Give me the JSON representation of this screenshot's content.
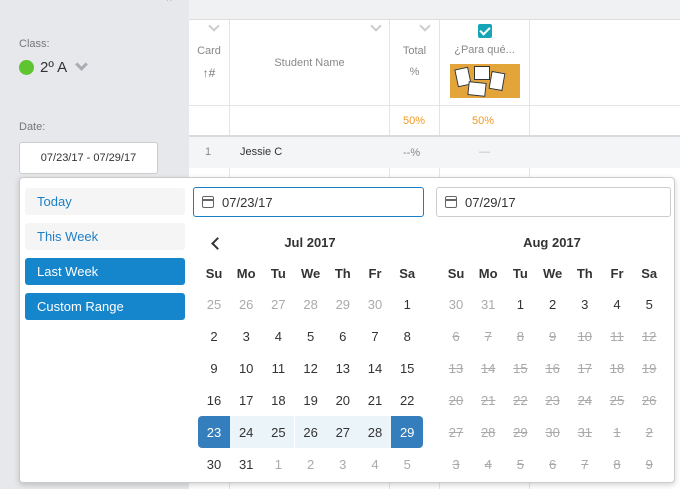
{
  "sidebar": {
    "corner_glyph": "×",
    "class_label": "Class:",
    "class_value": "2º A",
    "date_label": "Date:",
    "date_value": "07/23/17 - 07/29/17"
  },
  "grid": {
    "header_top_text": "",
    "columns": {
      "card_label": "Card",
      "card_sub": "↑#",
      "student_label": "Student Name",
      "total_label": "Total",
      "total_sub": "%",
      "activity_label": "¿Para qué..."
    },
    "summary": {
      "total_pct": "50%",
      "activity_pct": "50%"
    },
    "rows": [
      {
        "card": "1",
        "name": "Jessie C",
        "total": "--%",
        "activity": "—"
      }
    ],
    "colors": {
      "orange": "#f39a21",
      "check": "#16a4b7"
    }
  },
  "picker": {
    "ranges": [
      {
        "label": "Today",
        "state": "plain"
      },
      {
        "label": "This Week",
        "state": "plain"
      },
      {
        "label": "Last Week",
        "state": "active"
      },
      {
        "label": "Custom Range",
        "state": "active"
      }
    ],
    "start_input": "07/23/17",
    "end_input": "07/29/17",
    "weekdays": [
      "Su",
      "Mo",
      "Tu",
      "We",
      "Th",
      "Fr",
      "Sa"
    ],
    "left_month": {
      "title": "Jul 2017",
      "weeks": [
        [
          [
            "25",
            "off"
          ],
          [
            "26",
            "off"
          ],
          [
            "27",
            "off"
          ],
          [
            "28",
            "off"
          ],
          [
            "29",
            "off"
          ],
          [
            "30",
            "off"
          ],
          [
            "1",
            ""
          ]
        ],
        [
          [
            "2",
            ""
          ],
          [
            "3",
            ""
          ],
          [
            "4",
            ""
          ],
          [
            "5",
            ""
          ],
          [
            "6",
            ""
          ],
          [
            "7",
            ""
          ],
          [
            "8",
            ""
          ]
        ],
        [
          [
            "9",
            ""
          ],
          [
            "10",
            ""
          ],
          [
            "11",
            ""
          ],
          [
            "12",
            ""
          ],
          [
            "13",
            ""
          ],
          [
            "14",
            ""
          ],
          [
            "15",
            ""
          ]
        ],
        [
          [
            "16",
            ""
          ],
          [
            "17",
            ""
          ],
          [
            "18",
            ""
          ],
          [
            "19",
            ""
          ],
          [
            "20",
            ""
          ],
          [
            "21",
            ""
          ],
          [
            "22",
            ""
          ]
        ],
        [
          [
            "23",
            "sel sel-start"
          ],
          [
            "24",
            "inrange"
          ],
          [
            "25",
            "inrange"
          ],
          [
            "26",
            "inrange"
          ],
          [
            "27",
            "inrange"
          ],
          [
            "28",
            "inrange"
          ],
          [
            "29",
            "sel sel-end"
          ]
        ],
        [
          [
            "30",
            ""
          ],
          [
            "31",
            ""
          ],
          [
            "1",
            "off"
          ],
          [
            "2",
            "off"
          ],
          [
            "3",
            "off"
          ],
          [
            "4",
            "off"
          ],
          [
            "5",
            "off"
          ]
        ]
      ]
    },
    "right_month": {
      "title": "Aug 2017",
      "weeks": [
        [
          [
            "30",
            "off"
          ],
          [
            "31",
            "off"
          ],
          [
            "1",
            ""
          ],
          [
            "2",
            ""
          ],
          [
            "3",
            ""
          ],
          [
            "4",
            ""
          ],
          [
            "5",
            ""
          ]
        ],
        [
          [
            "6",
            "dis"
          ],
          [
            "7",
            "dis"
          ],
          [
            "8",
            "dis"
          ],
          [
            "9",
            "dis"
          ],
          [
            "10",
            "dis"
          ],
          [
            "11",
            "dis"
          ],
          [
            "12",
            "dis"
          ]
        ],
        [
          [
            "13",
            "dis"
          ],
          [
            "14",
            "dis"
          ],
          [
            "15",
            "dis"
          ],
          [
            "16",
            "dis"
          ],
          [
            "17",
            "dis"
          ],
          [
            "18",
            "dis"
          ],
          [
            "19",
            "dis"
          ]
        ],
        [
          [
            "20",
            "dis"
          ],
          [
            "21",
            "dis"
          ],
          [
            "22",
            "dis"
          ],
          [
            "23",
            "dis"
          ],
          [
            "24",
            "dis"
          ],
          [
            "25",
            "dis"
          ],
          [
            "26",
            "dis"
          ]
        ],
        [
          [
            "27",
            "dis"
          ],
          [
            "28",
            "dis"
          ],
          [
            "29",
            "dis"
          ],
          [
            "30",
            "dis"
          ],
          [
            "31",
            "dis"
          ],
          [
            "1",
            "dis"
          ],
          [
            "2",
            "dis"
          ]
        ],
        [
          [
            "3",
            "dis"
          ],
          [
            "4",
            "dis"
          ],
          [
            "5",
            "dis"
          ],
          [
            "6",
            "dis"
          ],
          [
            "7",
            "dis"
          ],
          [
            "8",
            "dis"
          ],
          [
            "9",
            "dis"
          ]
        ]
      ]
    },
    "colors": {
      "selected": "#357ebd",
      "in_range": "#ebf4f8",
      "range_active": "#1686cc"
    }
  }
}
